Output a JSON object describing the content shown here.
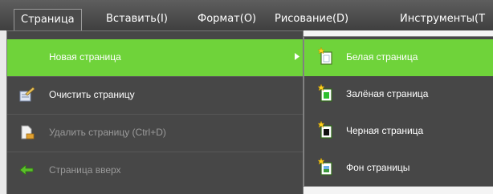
{
  "menubar": {
    "items": [
      {
        "label": "Страница"
      },
      {
        "label": "Вставить(I)"
      },
      {
        "label": "Формат(O)"
      },
      {
        "label": "Рисование(D)"
      },
      {
        "label": "Инструменты(T"
      }
    ]
  },
  "page_menu": {
    "items": [
      {
        "label": "Новая страница",
        "icon": "none",
        "state": "highlighted",
        "has_submenu": true
      },
      {
        "label": "Очистить страницу",
        "icon": "clear-page-icon",
        "state": "enabled"
      },
      {
        "label": "Удалить страницу (Ctrl+D)",
        "icon": "delete-page-icon",
        "state": "disabled"
      },
      {
        "label": "Страница вверх",
        "icon": "arrow-up-page-icon",
        "state": "disabled"
      }
    ]
  },
  "new_page_submenu": {
    "items": [
      {
        "label": "Белая страница",
        "icon": "white-page-icon",
        "state": "highlighted"
      },
      {
        "label": "Залёная страница",
        "icon": "green-page-icon",
        "state": "enabled"
      },
      {
        "label": "Черная страница",
        "icon": "black-page-icon",
        "state": "enabled"
      },
      {
        "label": "Фон страницы",
        "icon": "page-background-icon",
        "state": "enabled"
      }
    ]
  },
  "colors": {
    "highlight": "#6fd33a",
    "menu_bg": "#474747",
    "menubar_bg": "#4a4a4a",
    "text": "#ffffff",
    "disabled_text": "#9a9a9a"
  }
}
